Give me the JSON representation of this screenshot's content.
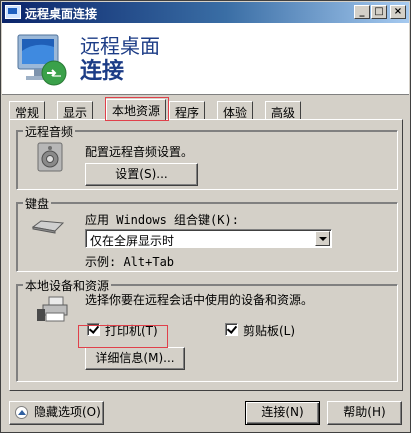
{
  "window": {
    "title": "远程桌面连接"
  },
  "banner": {
    "line1": "远程桌面",
    "line2": "连接"
  },
  "tabs": [
    {
      "label": "常规"
    },
    {
      "label": "显示"
    },
    {
      "label": "本地资源",
      "active": true
    },
    {
      "label": "程序"
    },
    {
      "label": "体验"
    },
    {
      "label": "高级"
    }
  ],
  "audio": {
    "group_title": "远程音频",
    "description": "配置远程音频设置。",
    "settings_button": "设置(S)..."
  },
  "keyboard": {
    "group_title": "键盘",
    "apply_label": "应用 Windows 组合键(K):",
    "selected_option": "仅在全屏显示时",
    "example": "示例: Alt+Tab"
  },
  "devices": {
    "group_title": "本地设备和资源",
    "description": "选择你要在远程会话中使用的设备和资源。",
    "printers_label": "打印机(T)",
    "printers_checked": true,
    "clipboard_label": "剪贴板(L)",
    "clipboard_checked": true,
    "details_button": "详细信息(M)..."
  },
  "footer": {
    "hide_options": "隐藏选项(O)",
    "connect_button": "连接(N)",
    "help_button": "帮助(H)"
  },
  "colors": {
    "accent_outline": "#e0404a",
    "title_blue": "#0a246a",
    "banner_text": "#1c3c86"
  }
}
